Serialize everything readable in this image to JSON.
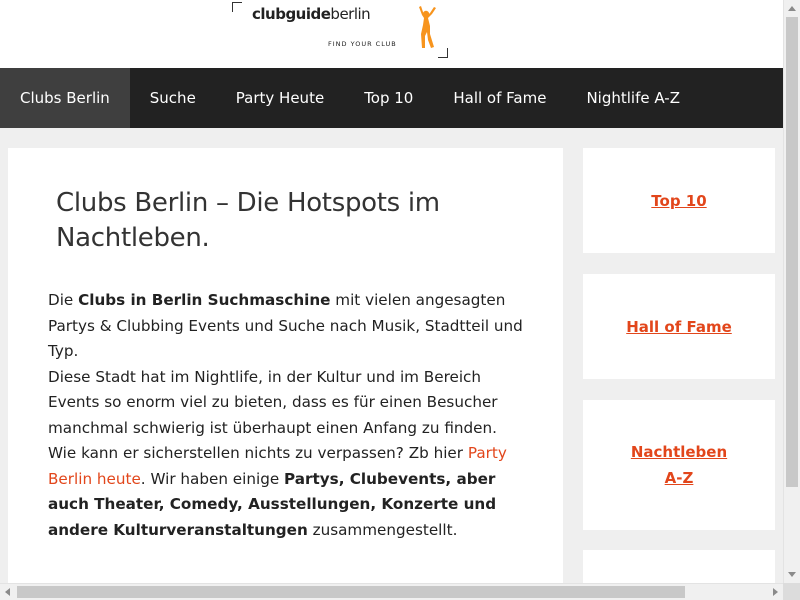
{
  "header": {
    "logo": {
      "brand_bold": "clubguide",
      "brand_light": "berlin",
      "tagline": "FIND YOUR CLUB"
    }
  },
  "nav": {
    "items": [
      {
        "label": "Clubs Berlin",
        "active": true
      },
      {
        "label": "Suche"
      },
      {
        "label": "Party Heute"
      },
      {
        "label": "Top 10"
      },
      {
        "label": "Hall of Fame"
      },
      {
        "label": "Nightlife A-Z"
      }
    ]
  },
  "main": {
    "title": "Clubs Berlin – Die Hotspots im Nachtleben.",
    "p1_pre": "Die ",
    "p1_bold": "Clubs in Berlin Suchmaschine",
    "p1_post": " mit vielen angesagten Partys & Clubbing Events und Suche nach Musik, Stadtteil und Typ.",
    "p2_pre": "Diese Stadt hat im Nightlife, in der Kultur und im Bereich Events so enorm viel zu bieten, dass es für einen Besucher manchmal schwierig ist überhaupt einen Anfang zu finden. Wie kann er sicherstellen nichts zu verpassen? Zb hier ",
    "p2_link": "Party Berlin heute",
    "p2_mid": ". Wir haben einige ",
    "p2_bold": "Partys, Clubevents, aber auch Theater, Comedy, Ausstellungen, Konzerte und andere Kulturveranstaltungen",
    "p2_post": " zusammengestellt."
  },
  "sidebar": {
    "links": [
      {
        "line1": "Top 10"
      },
      {
        "line1": "Hall of Fame"
      },
      {
        "line1": "Nachtleben",
        "line2": "A-Z"
      }
    ]
  },
  "colors": {
    "accent": "#e2461b",
    "nav_bg": "#222222",
    "nav_active": "#3f3f3f",
    "logo_figure": "#f7941d",
    "page_bg": "#efefef"
  }
}
